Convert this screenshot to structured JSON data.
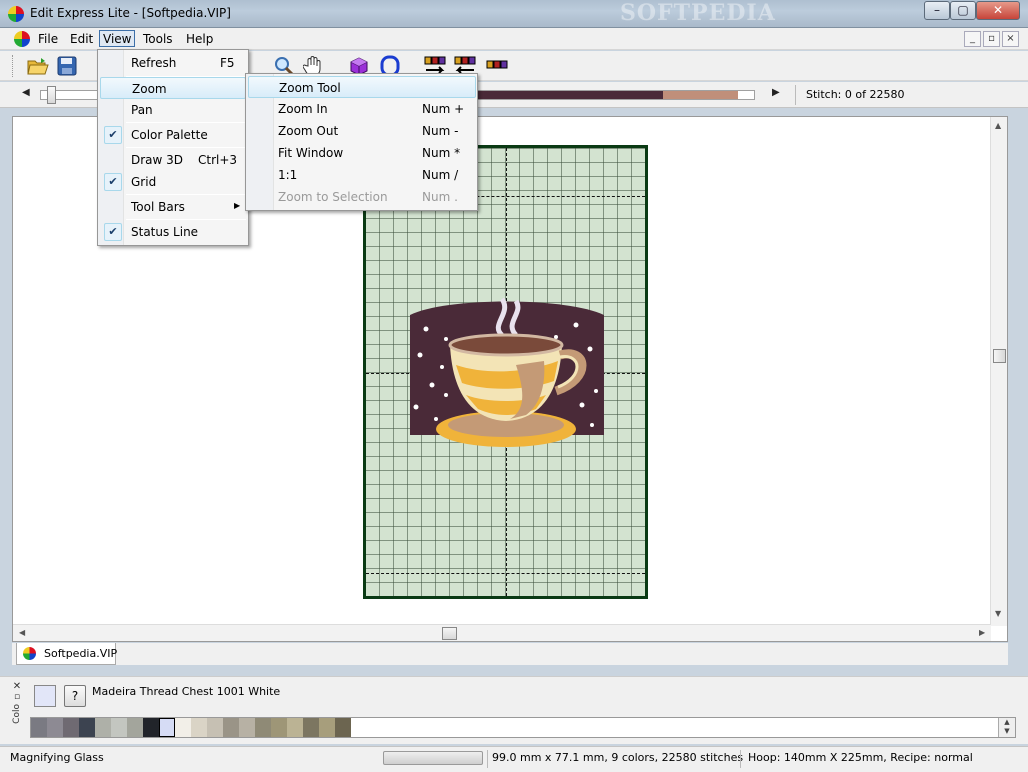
{
  "window": {
    "title": "Edit Express Lite - [Softpedia.VIP]",
    "watermark": "SOFTPEDIA",
    "minimize_glyph": "–",
    "maximize_glyph": "▢",
    "close_glyph": "✕"
  },
  "menubar": {
    "items": [
      "File",
      "Edit",
      "View",
      "Tools",
      "Help"
    ],
    "active": "View",
    "mdi_buttons": [
      "_",
      "▫",
      "×"
    ]
  },
  "toolbar": {
    "buttons": [
      "open-folder-icon",
      "save-disk-icon",
      "zoom-magnifier-icon",
      "pan-hand-icon",
      "3d-cube-icon",
      "hoop-icon",
      "thread-colors-icon",
      "thread-next-icon",
      "thread-prev-icon"
    ]
  },
  "stitchbar": {
    "left_arrow": "◀",
    "right_arrow": "▶",
    "stitch_label": "Stitch:  0 of 22580",
    "progress_fraction": 0
  },
  "view_menu": {
    "items": [
      {
        "label": "Refresh",
        "shortcut": "F5",
        "checked": false
      },
      {
        "label": "Zoom",
        "shortcut": "",
        "checked": false,
        "highlighted": true
      },
      {
        "label": "Pan",
        "shortcut": "",
        "checked": false
      },
      {
        "label": "Color Palette",
        "shortcut": "",
        "checked": true
      },
      {
        "label": "Draw 3D",
        "shortcut": "Ctrl+3",
        "checked": false
      },
      {
        "label": "Grid",
        "shortcut": "",
        "checked": true
      },
      {
        "label": "Tool Bars",
        "shortcut": "",
        "checked": false,
        "submenu": true
      },
      {
        "label": "Status Line",
        "shortcut": "",
        "checked": true
      }
    ],
    "check_glyph": "✔",
    "submenu_glyph": "▶"
  },
  "zoom_menu": {
    "items": [
      {
        "label": "Zoom Tool",
        "shortcut": "",
        "highlighted": true
      },
      {
        "label": "Zoom In",
        "shortcut": "Num +"
      },
      {
        "label": "Zoom Out",
        "shortcut": "Num -"
      },
      {
        "label": "Fit Window",
        "shortcut": "Num *"
      },
      {
        "label": "1:1",
        "shortcut": "Num /"
      },
      {
        "label": "Zoom to Selection",
        "shortcut": "Num .",
        "disabled": true
      }
    ]
  },
  "document": {
    "tab_label": "Softpedia.VIP"
  },
  "palette": {
    "help_label": "?",
    "thread_label": "Madeira Thread Chest 1001 White",
    "side_label": "Colo",
    "selected_color": "#e2e6f8",
    "swatches": [
      "#7a7a82",
      "#8d8a93",
      "#6f6a72",
      "#3c4350",
      "#aeb0a8",
      "#c3c6c0",
      "#a3a59c",
      "#21242a",
      "#d6dcf5",
      "#f2efe8",
      "#dad4c6",
      "#c6c0b3",
      "#9a9487",
      "#b7b1a4",
      "#8f8a76",
      "#9e9677",
      "#bbb394",
      "#7c7661",
      "#a79e7c",
      "#6c6550"
    ],
    "spin_up": "▲",
    "spin_down": "▼"
  },
  "statusbar": {
    "mode": "Magnifying Glass",
    "dimensions": "99.0 mm x 77.1 mm, 9 colors, 22580 stitches",
    "hoop": "Hoop: 140mm X 225mm, Recipe: normal"
  },
  "colors": {
    "hoop_border": "#0a3a14",
    "hoop_fill": "#d3e3d0",
    "design_background": "#4a2a38",
    "cup_gold": "#f0b33a",
    "cup_cream": "#f3e4b6",
    "cup_tan": "#c49a76"
  }
}
